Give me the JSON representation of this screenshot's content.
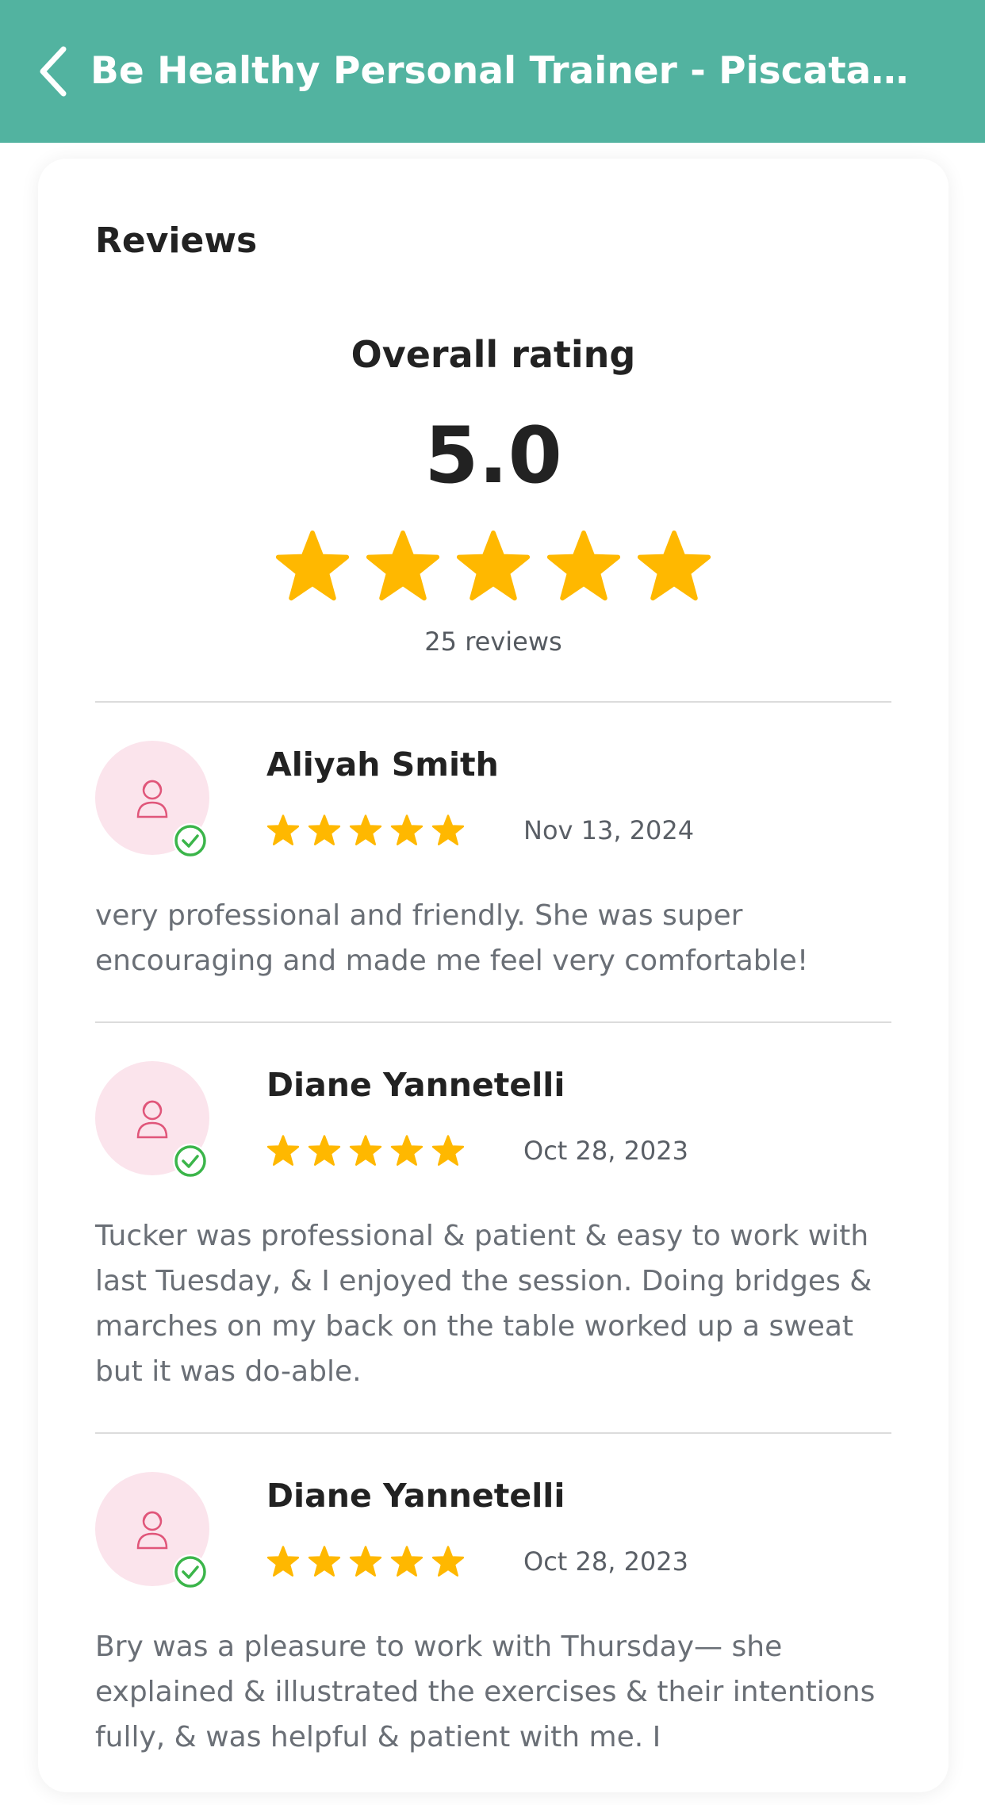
{
  "header": {
    "title": "Be Healthy Personal Trainer - Piscata…",
    "back_icon": "chevron-left-icon",
    "background": "#52b3a0"
  },
  "reviews_section": {
    "title": "Reviews",
    "overall_label": "Overall rating",
    "overall_value": "5.0",
    "overall_stars": 5,
    "review_count": "25 reviews",
    "star_color": "#ffb800"
  },
  "reviews": [
    {
      "name": "Aliyah Smith",
      "rating": 5,
      "date": "Nov 13, 2024",
      "verified": true,
      "text": "very professional and friendly. She was super encouraging and made me feel very comfortable!"
    },
    {
      "name": "Diane Yannetelli",
      "rating": 5,
      "date": "Oct 28, 2023",
      "verified": true,
      "text": "Tucker was professional & patient & easy to work with last Tuesday, & I enjoyed the session. Doing bridges & marches on my back on the table worked up a sweat but it was do-able."
    },
    {
      "name": "Diane Yannetelli",
      "rating": 5,
      "date": "Oct 28, 2023",
      "verified": true,
      "text": "Bry was a pleasure to work with Thursday— she explained & illustrated the exercises & their intentions fully, & was helpful & patient with me. I"
    }
  ]
}
